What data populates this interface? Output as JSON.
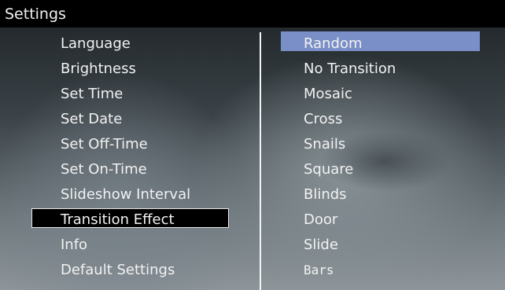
{
  "header": {
    "title": "Settings"
  },
  "settings_menu": {
    "items": [
      {
        "label": "Language"
      },
      {
        "label": "Brightness"
      },
      {
        "label": "Set Time"
      },
      {
        "label": "Set Date"
      },
      {
        "label": "Set Off-Time"
      },
      {
        "label": "Set On-Time"
      },
      {
        "label": "Slideshow Interval"
      },
      {
        "label": "Transition Effect",
        "selected": true
      },
      {
        "label": "Info"
      },
      {
        "label": "Default Settings"
      }
    ]
  },
  "transition_options": {
    "items": [
      {
        "label": "Random",
        "highlighted": true
      },
      {
        "label": "No Transition"
      },
      {
        "label": "Mosaic"
      },
      {
        "label": "Cross"
      },
      {
        "label": "Snails"
      },
      {
        "label": "Square"
      },
      {
        "label": "Blinds"
      },
      {
        "label": "Door"
      },
      {
        "label": "Slide"
      },
      {
        "label": "Bars"
      }
    ]
  },
  "colors": {
    "highlight": "#7a8fc7",
    "selection_bg": "#000000",
    "selection_border": "#e8e8e8",
    "title_bar": "#000000"
  }
}
